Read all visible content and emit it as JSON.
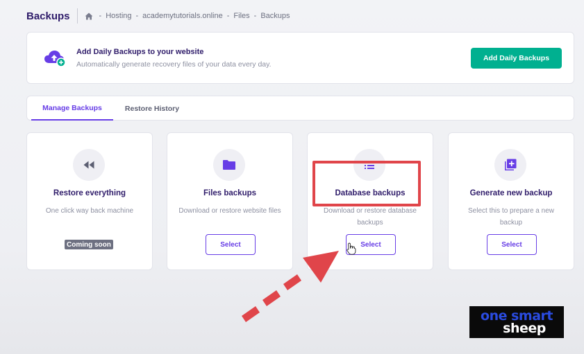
{
  "header": {
    "title": "Backups",
    "breadcrumb": {
      "home_icon": "home-icon",
      "items": [
        "Hosting",
        "academytutorials.online",
        "Files",
        "Backups"
      ]
    }
  },
  "banner": {
    "icon": "cloud-upload-plus-icon",
    "title": "Add Daily Backups to your website",
    "subtitle": "Automatically generate recovery files of your data every day.",
    "button_label": "Add Daily Backups"
  },
  "tabs": [
    {
      "label": "Manage Backups",
      "active": true
    },
    {
      "label": "Restore History",
      "active": false
    }
  ],
  "cards": [
    {
      "icon": "rewind-icon",
      "title": "Restore everything",
      "description": "One click way back machine",
      "badge": "Coming soon"
    },
    {
      "icon": "folder-icon",
      "title": "Files backups",
      "description": "Download or restore website files",
      "button_label": "Select"
    },
    {
      "icon": "list-icon",
      "title": "Database backups",
      "description": "Download or restore database backups",
      "button_label": "Select"
    },
    {
      "icon": "add-copy-icon",
      "title": "Generate new backup",
      "description": "Select this to prepare a new backup",
      "button_label": "Select"
    }
  ],
  "overlay": {
    "logo_line1": "one smart",
    "logo_line2": "sheep"
  },
  "colors": {
    "primary": "#673de6",
    "success": "#00b090",
    "heading": "#2f1c6a",
    "highlight": "#e0454a"
  }
}
